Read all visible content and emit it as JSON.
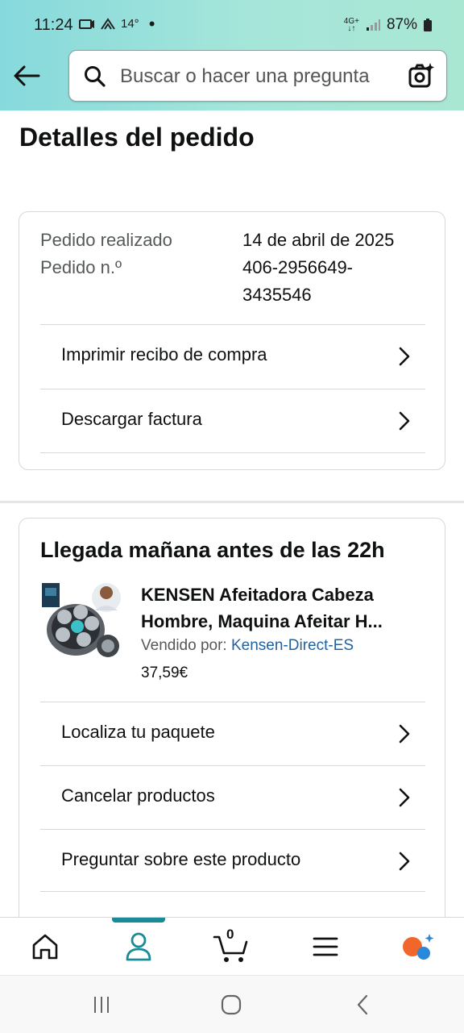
{
  "status_bar": {
    "time": "11:24",
    "temperature": "14°",
    "network": "4G+",
    "battery": "87%"
  },
  "header": {
    "search_placeholder": "Buscar o hacer una pregunta"
  },
  "page_title": "Detalles del pedido",
  "order": {
    "placed_label": "Pedido realizado",
    "placed_value": "14 de abril de 2025",
    "number_label": "Pedido n.º",
    "number_value_line1": "406-2956649-",
    "number_value_line2": "3435546",
    "links": [
      "Imprimir recibo de compra",
      "Descargar factura"
    ]
  },
  "shipment": {
    "heading": "Llegada mañana antes de las 22h",
    "product_title_line1": "KENSEN Afeitadora Cabeza",
    "product_title_line2": "Hombre, Maquina Afeitar H...",
    "sold_by_label": "Vendido por:",
    "seller": "Kensen-Direct-ES",
    "price": "37,59€",
    "links": [
      "Localiza tu paquete",
      "Cancelar productos",
      "Preguntar sobre este producto"
    ]
  },
  "bottom_nav": {
    "cart_count": "0",
    "items": [
      "home-icon",
      "account-icon",
      "cart-icon",
      "menu-icon",
      "rufus-icon"
    ],
    "active_color": "#1a8a96"
  },
  "colors": {
    "header_bg": "#a6e6da",
    "link_blue": "#2162a1"
  }
}
